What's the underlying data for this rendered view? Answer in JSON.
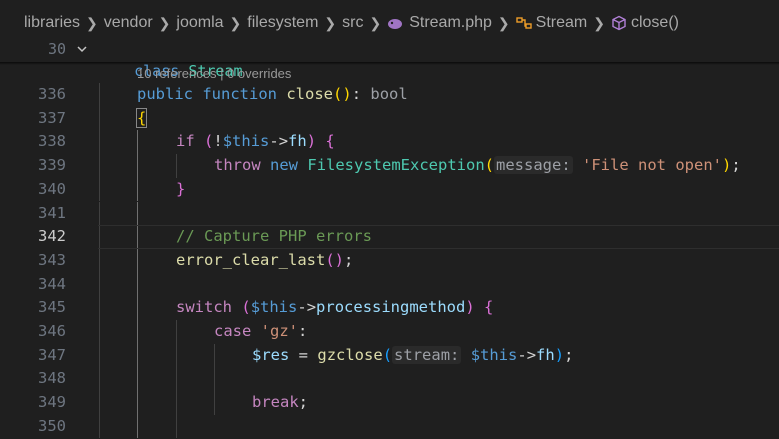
{
  "breadcrumb": {
    "items": [
      "libraries",
      "vendor",
      "joomla",
      "filesystem",
      "src",
      "Stream.php",
      "Stream",
      "close()"
    ],
    "separator": ">"
  },
  "sticky": {
    "line_number": "30",
    "keyword": "class",
    "name": "Stream"
  },
  "codelens": "10 references | 0 overrides",
  "editor": {
    "active_line": "342",
    "lines": [
      {
        "num": "336",
        "t": [
          "public",
          "function",
          "close",
          "(",
          ")",
          ":",
          "bool"
        ]
      },
      {
        "num": "337",
        "t": [
          "{"
        ]
      },
      {
        "num": "338",
        "t": [
          "if",
          "(",
          "!",
          "$this",
          "->",
          "fh",
          ")",
          "{"
        ]
      },
      {
        "num": "339",
        "t": [
          "throw",
          "new",
          "FilesystemException",
          "(",
          "message:",
          "'File not open'",
          ")",
          ";"
        ]
      },
      {
        "num": "340",
        "t": [
          "}"
        ]
      },
      {
        "num": "341",
        "t": []
      },
      {
        "num": "342",
        "t": [
          "// Capture PHP errors"
        ]
      },
      {
        "num": "343",
        "t": [
          "error_clear_last",
          "(",
          ")",
          ";"
        ]
      },
      {
        "num": "344",
        "t": []
      },
      {
        "num": "345",
        "t": [
          "switch",
          "(",
          "$this",
          "->",
          "processingmethod",
          ")",
          "{"
        ]
      },
      {
        "num": "346",
        "t": [
          "case",
          "'gz'",
          ":"
        ]
      },
      {
        "num": "347",
        "t": [
          "$res",
          "=",
          "gzclose",
          "(",
          "stream:",
          "$this",
          "->",
          "fh",
          ")",
          ";"
        ]
      },
      {
        "num": "348",
        "t": []
      },
      {
        "num": "349",
        "t": [
          "break",
          ";"
        ]
      },
      {
        "num": "350",
        "t": []
      }
    ]
  },
  "colors": {
    "background": "#1f1f1f",
    "keyword": "#569cd6",
    "control": "#c586c0",
    "function": "#dcdcaa",
    "variable": "#9cdcfe",
    "class": "#4ec9b0",
    "string": "#ce9178",
    "comment": "#6a9955"
  },
  "icons": {
    "php_file": "php-elephant-icon",
    "class": "class-symbol-icon",
    "method": "method-cube-icon",
    "fold": "chevron-down-icon"
  }
}
